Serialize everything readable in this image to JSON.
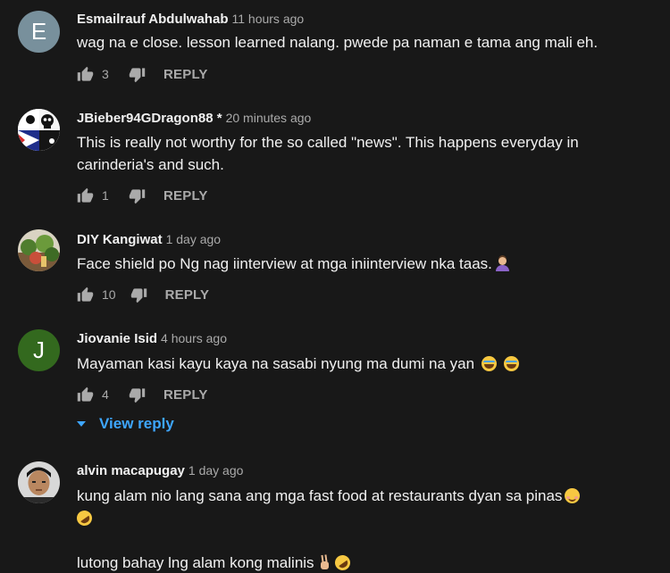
{
  "comments": [
    {
      "author": "Esmailrauf Abdulwahab",
      "time": "11 hours ago",
      "avatar_letter": "E",
      "avatar_color": "#78909c",
      "text_lines": [
        "wag na e close. lesson learned nalang. pwede pa naman e tama ang mali eh."
      ],
      "likes": "3",
      "reply_label": "REPLY"
    },
    {
      "author": "JBieber94GDragon88 *",
      "time": "20 minutes ago",
      "avatar_icon": "skull-flag-avatar",
      "text_lines": [
        "This is really not worthy for the so called \"news\". This happens everyday in",
        "carinderia's and such."
      ],
      "likes": "1",
      "reply_label": "REPLY"
    },
    {
      "author": "DIY Kangiwat",
      "time": "1 day ago",
      "avatar_icon": "plants-photo-avatar",
      "text_lines": [
        "Face shield po Ng nag iinterview at mga iniinterview nka taas."
      ],
      "likes": "10",
      "reply_label": "REPLY"
    },
    {
      "author": "Jiovanie Isid",
      "time": "4 hours ago",
      "avatar_letter": "J",
      "avatar_color": "#33691e",
      "text_lines": [
        "Mayaman kasi kayu kaya na sasabi nyung ma dumi na yan"
      ],
      "likes": "4",
      "reply_label": "REPLY",
      "view_reply_label": "View reply"
    },
    {
      "author": "alvin macapugay",
      "time": "1 day ago",
      "avatar_icon": "person-photo-avatar",
      "text_lines": [
        "kung alam nio lang sana ang mga fast food at restaurants dyan sa pinas",
        "",
        "",
        "lutong bahay lng alam kong malinis"
      ]
    }
  ],
  "colors": {
    "background": "#181818",
    "text": "#f1f1f1",
    "meta": "#aaaaaa",
    "link": "#3ea6ff"
  },
  "icons": {
    "like": "thumbs-up-icon",
    "dislike": "thumbs-down-icon",
    "expand": "caret-down-icon"
  }
}
